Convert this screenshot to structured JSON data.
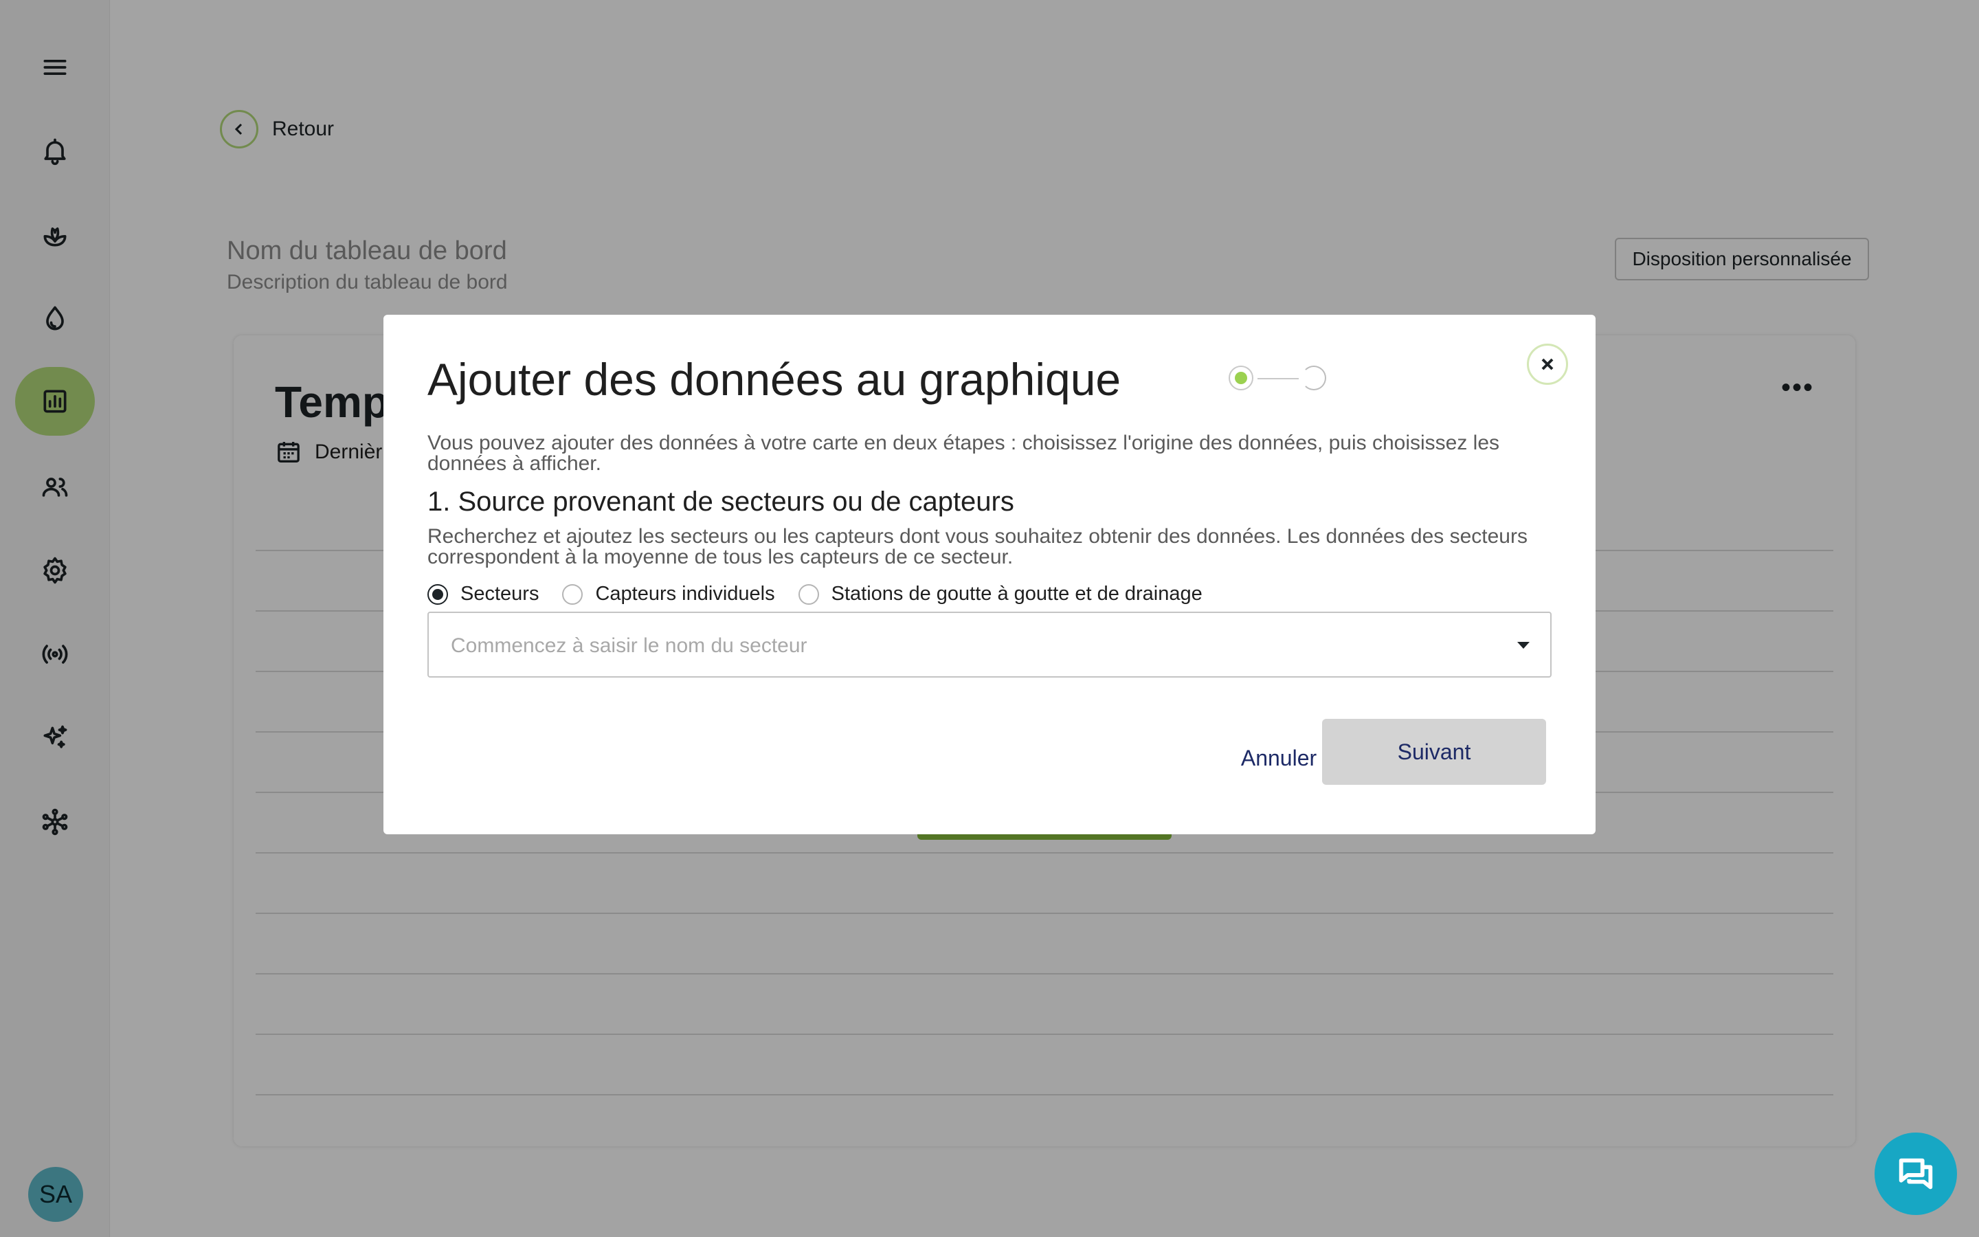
{
  "sidebar": {
    "items": [
      {
        "icon": "menu-icon"
      },
      {
        "icon": "bell-icon"
      },
      {
        "icon": "plant-icon"
      },
      {
        "icon": "water-drop-icon"
      },
      {
        "icon": "chart-icon",
        "active": true
      },
      {
        "icon": "users-icon"
      },
      {
        "icon": "gear-icon"
      },
      {
        "icon": "broadcast-icon"
      },
      {
        "icon": "sparkles-icon"
      },
      {
        "icon": "network-icon"
      }
    ],
    "avatar_initials": "SA",
    "active_color": "#b3d97a"
  },
  "header": {
    "back_label": "Retour",
    "dashboard_name": "Nom du tableau de bord",
    "dashboard_description": "Description du tableau de bord",
    "layout_button": "Disposition personnalisée"
  },
  "card": {
    "title": "Temp",
    "date_label": "Dernièr",
    "more_icon": "more-horizontal-icon"
  },
  "modal": {
    "title": "Ajouter des données au graphique",
    "stepper": {
      "current_step": 1,
      "total_steps": 2
    },
    "intro": "Vous pouvez ajouter des données à votre carte en deux étapes : choisissez l'origine des données, puis choisissez les données à afficher.",
    "section_title": "1. Source provenant de secteurs ou de capteurs",
    "help": "Recherchez et ajoutez les secteurs ou les capteurs dont vous souhaitez obtenir des données. Les données des secteurs correspondent à la moyenne de tous les capteurs de ce secteur.",
    "source_options": [
      {
        "label": "Secteurs",
        "checked": true
      },
      {
        "label": "Capteurs individuels",
        "checked": false
      },
      {
        "label": "Stations de goutte à goutte et de drainage",
        "checked": false
      }
    ],
    "search": {
      "placeholder": "Commencez à saisir le nom du secteur",
      "value": ""
    },
    "cancel_label": "Annuler",
    "next_label": "Suivant"
  },
  "colors": {
    "accent_green": "#9bd150",
    "chat_button": "#17a7c4",
    "button_text": "#1d2a66"
  }
}
